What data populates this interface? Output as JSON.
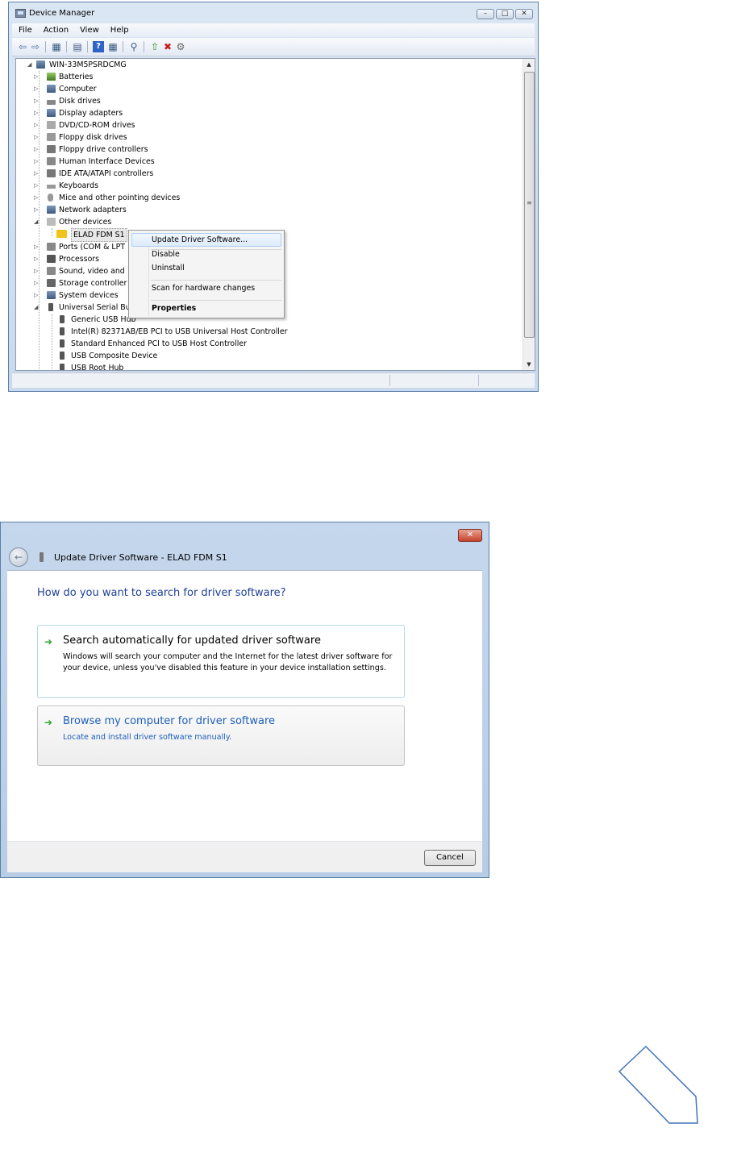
{
  "device_manager": {
    "title": "Device Manager",
    "menu": [
      "File",
      "Action",
      "View",
      "Help"
    ],
    "computer_name": "WIN-33M5PSRDCMG",
    "categories": [
      "Batteries",
      "Computer",
      "Disk drives",
      "Display adapters",
      "DVD/CD-ROM drives",
      "Floppy disk drives",
      "Floppy drive controllers",
      "Human Interface Devices",
      "IDE ATA/ATAPI controllers",
      "Keyboards",
      "Mice and other pointing devices",
      "Network adapters",
      "Other devices"
    ],
    "other_device_child": "ELAD FDM S1",
    "categories_after": [
      "Ports (COM & LPT",
      "Processors",
      "Sound, video and",
      "Storage controller",
      "System devices",
      "Universal Serial Bu"
    ],
    "usb_children": [
      "Generic USB Hub",
      "Intel(R) 82371AB/EB PCI to USB Universal Host Controller",
      "Standard Enhanced PCI to USB Host Controller",
      "USB Composite Device",
      "USB Root Hub"
    ],
    "context_menu": {
      "update": "Update Driver Software...",
      "disable": "Disable",
      "uninstall": "Uninstall",
      "scan": "Scan for hardware changes",
      "properties": "Properties"
    }
  },
  "update_dialog": {
    "title": "Update Driver Software - ELAD FDM S1",
    "question": "How do you want to search for driver software?",
    "option_auto": {
      "title": "Search automatically for updated driver software",
      "description": "Windows will search your computer and the Internet for the latest driver software for your device, unless you've disabled this feature in your device installation settings."
    },
    "option_browse": {
      "title": "Browse my computer for driver software",
      "description": "Locate and install driver software manually."
    },
    "cancel_label": "Cancel"
  },
  "colors": {
    "link_blue": "#1d5fbd",
    "heading_blue": "#1d3f98",
    "arrow_green": "#2fa62f",
    "shape_stroke": "#3f73b8"
  }
}
